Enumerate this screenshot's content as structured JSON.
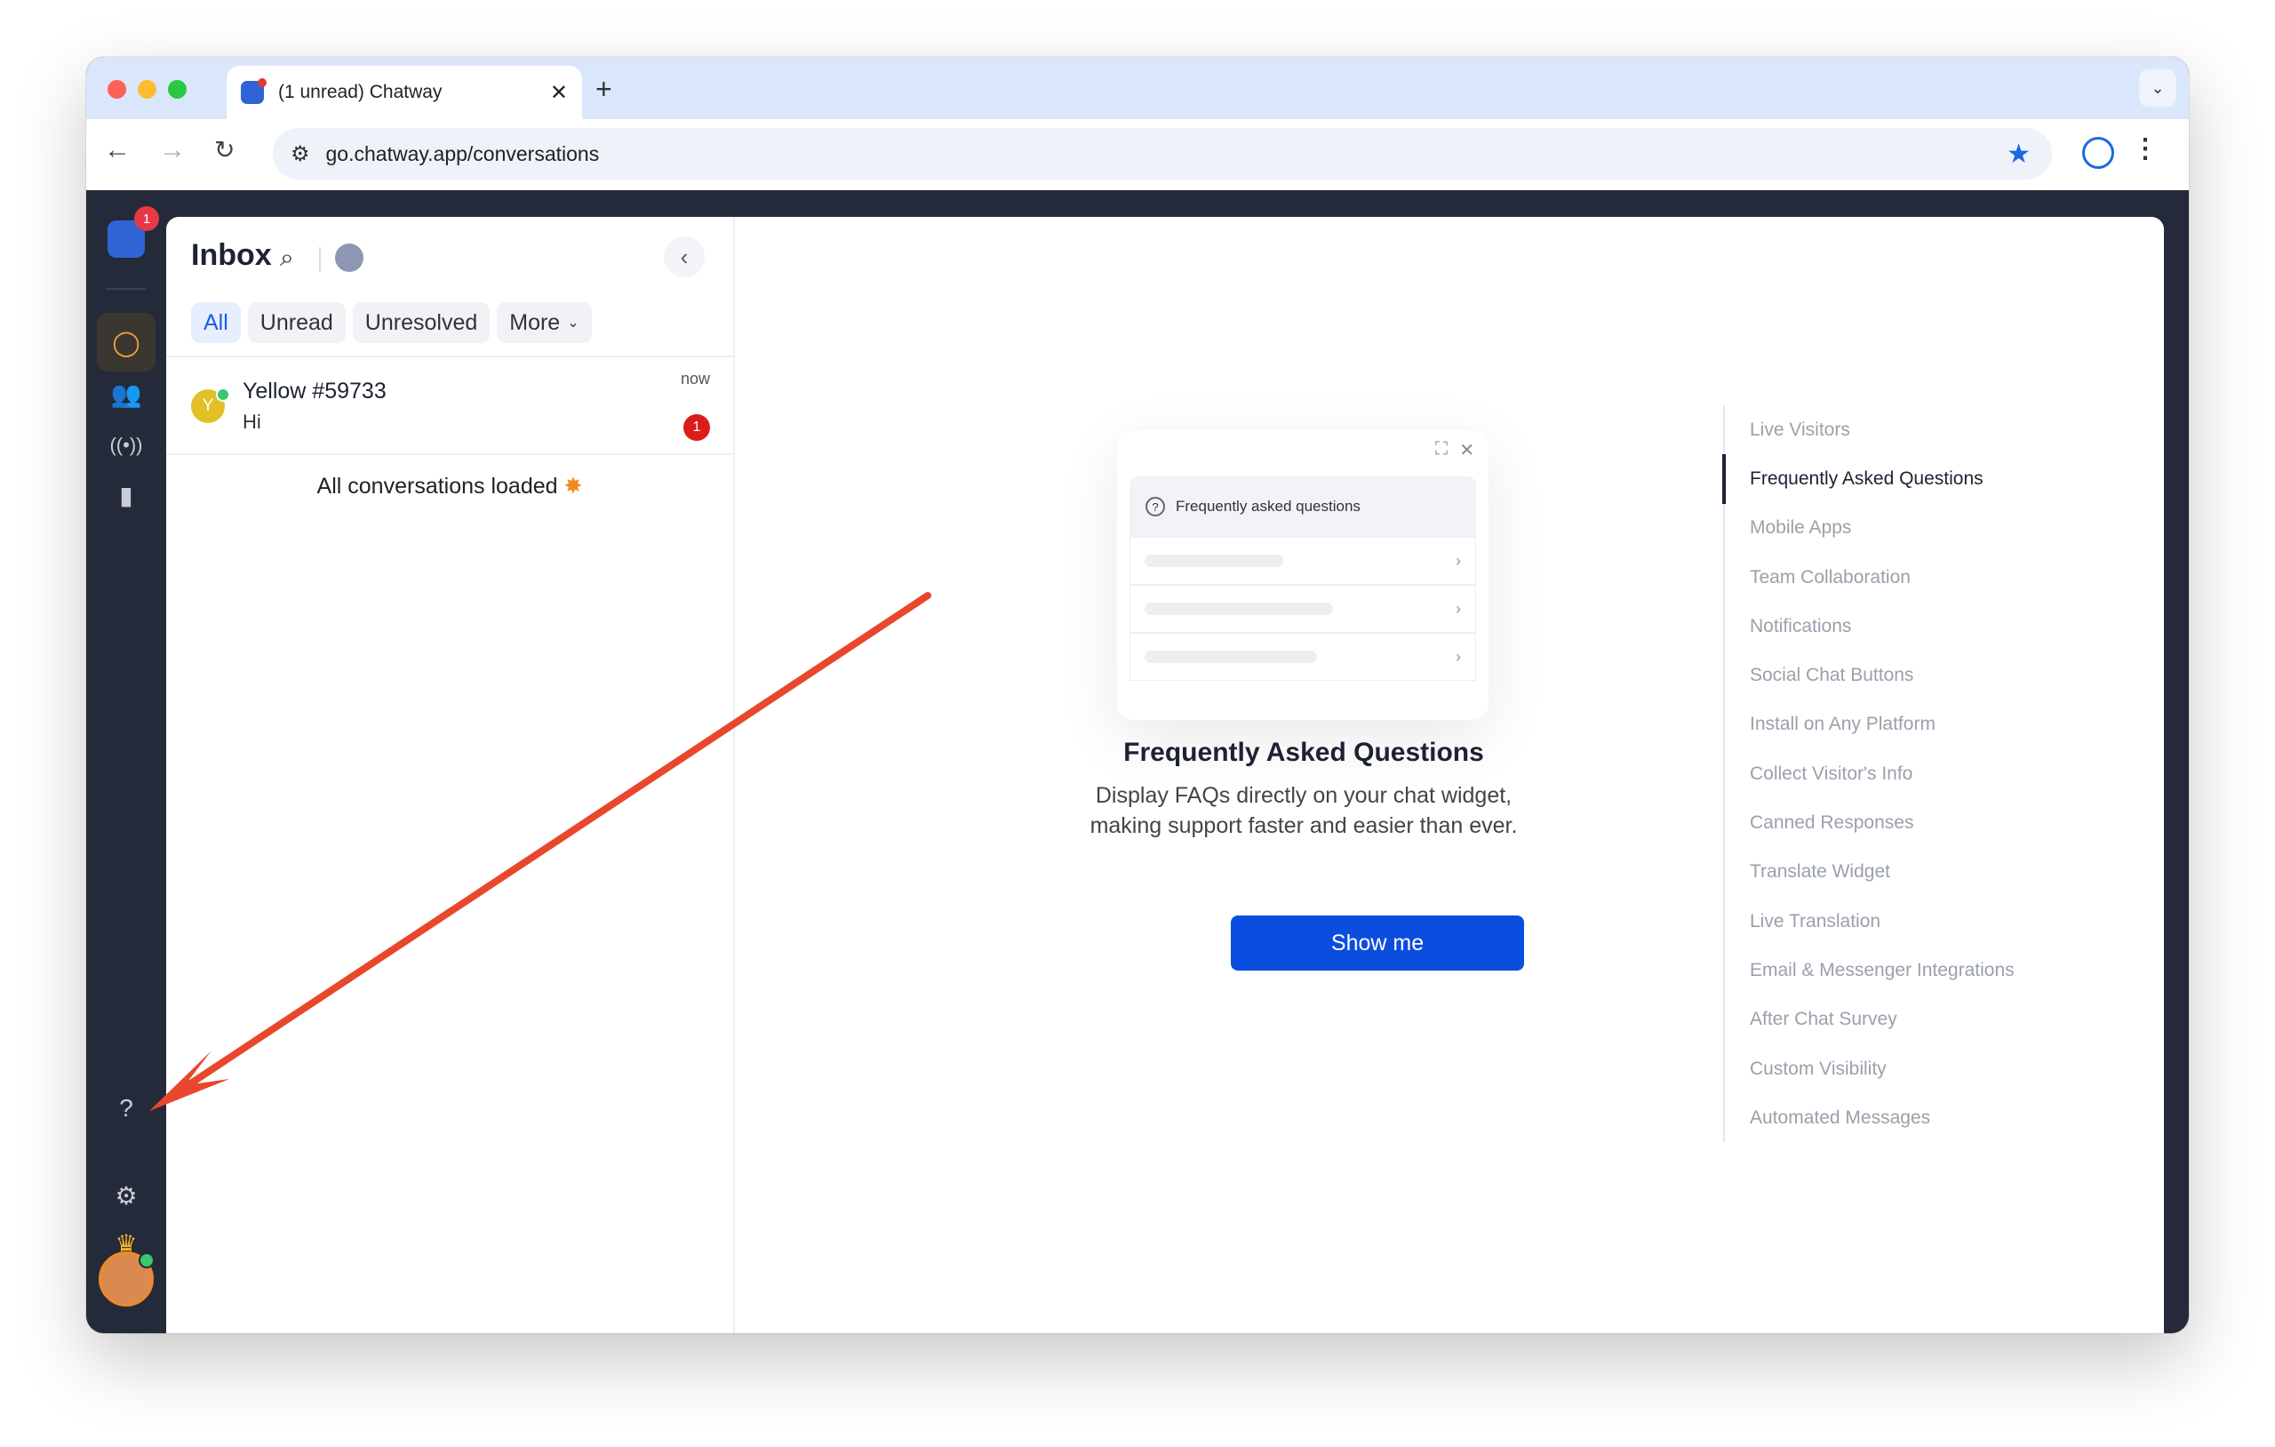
{
  "browser": {
    "tab_title": "(1 unread) Chatway",
    "tab_close": "✕",
    "new_tab": "+",
    "url": "go.chatway.app/conversations",
    "tab_dropdown": "⌄"
  },
  "rail": {
    "logo_badge": "1",
    "items": [
      "chat-icon",
      "users-icon",
      "broadcast-icon",
      "analytics-icon",
      "help-icon",
      "settings-icon",
      "crown-icon"
    ]
  },
  "inbox": {
    "title": "Inbox",
    "filters": [
      "All",
      "Unread",
      "Unresolved",
      "More"
    ],
    "conversation": {
      "avatar_letter": "Y",
      "name": "Yellow #59733",
      "message": "Hi",
      "time": "now",
      "unread": "1"
    },
    "loaded_text": "All conversations loaded"
  },
  "feature": {
    "preview_header": "Frequently asked questions",
    "title": "Frequently Asked Questions",
    "description": "Display FAQs directly on your chat widget, making support faster and easier than ever.",
    "button": "Show me",
    "list": [
      "Live Visitors",
      "Frequently Asked Questions",
      "Mobile Apps",
      "Team Collaboration",
      "Notifications",
      "Social Chat Buttons",
      "Install on Any Platform",
      "Collect Visitor's Info",
      "Canned Responses",
      "Translate Widget",
      "Live Translation",
      "Email & Messenger Integrations",
      "After Chat Survey",
      "Custom Visibility",
      "Automated Messages"
    ],
    "active_index": 1
  },
  "colors": {
    "accent": "#0b4edf",
    "rail_bg": "#252a3a",
    "annotation_arrow": "#e8472c"
  }
}
